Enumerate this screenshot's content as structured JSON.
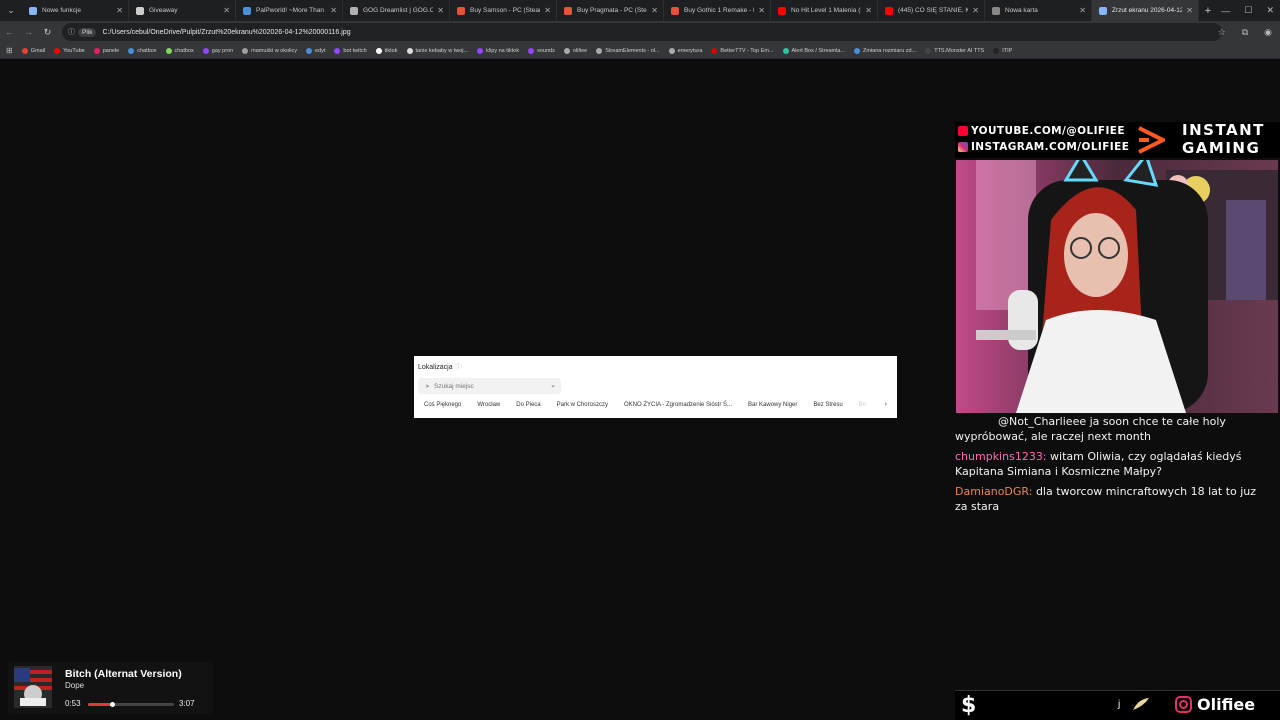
{
  "browser": {
    "tabs": [
      {
        "title": "Nowe funkcje",
        "color": "#8ab4f8",
        "active": false
      },
      {
        "title": "Giveaway",
        "color": "#cccccc",
        "active": false
      },
      {
        "title": "PalPworld! ~More Than a",
        "color": "#4a90d9",
        "active": false
      },
      {
        "title": "GOG Dreamlist | GOG.COM",
        "color": "#b0b0b0",
        "active": false
      },
      {
        "title": "Buy Samson - PC (Steam)",
        "color": "#e8523a",
        "active": false
      },
      {
        "title": "Buy Pragmata - PC (Steam)",
        "color": "#e8523a",
        "active": false
      },
      {
        "title": "Buy Gothic 1 Remake - P",
        "color": "#e8523a",
        "active": false
      },
      {
        "title": "No Hit Level 1 Malenia (B",
        "color": "#ff0000",
        "active": false
      },
      {
        "title": "(445) CO SIĘ STANIE, KIED",
        "color": "#ff0000",
        "active": false
      },
      {
        "title": "Nowa karta",
        "color": "#888888",
        "active": false
      },
      {
        "title": "Zrzut ekranu 2026-04-12",
        "color": "#8ab4f8",
        "active": true
      }
    ],
    "new_tab": "+",
    "site_chip": "Plik",
    "url": "C:/Users/cebul/OneDrive/Pulpit/Zrzut%20ekranu%202026-04-12%20000116.jpg",
    "bookmarks": [
      {
        "label": "Gmail",
        "color": "#ea4335"
      },
      {
        "label": "YouTube",
        "color": "#ff0000"
      },
      {
        "label": "panele",
        "color": "#e91e63"
      },
      {
        "label": "chatbox",
        "color": "#4a90d9"
      },
      {
        "label": "chatbox",
        "color": "#7ed957"
      },
      {
        "label": "gay pron",
        "color": "#9146ff"
      },
      {
        "label": "mamuśki w okolicy",
        "color": "#9e9e9e"
      },
      {
        "label": "edyt",
        "color": "#4a90d9"
      },
      {
        "label": "bot twitch",
        "color": "#9146ff"
      },
      {
        "label": "tiktok",
        "color": "#ffffff"
      },
      {
        "label": "tanie kebaby w twoj...",
        "color": "#dddddd"
      },
      {
        "label": "klipy na tiktok",
        "color": "#9146ff"
      },
      {
        "label": "sounds",
        "color": "#9146ff"
      },
      {
        "label": "olifiee",
        "color": "#aaaaaa"
      },
      {
        "label": "StreamElements - ol...",
        "color": "#aaaaaa"
      },
      {
        "label": "emerytura",
        "color": "#aaaaaa"
      },
      {
        "label": "BetterTTV - Top Em...",
        "color": "#d50000"
      },
      {
        "label": "Alert Box / Streamla...",
        "color": "#31c3a2"
      },
      {
        "label": "Zmiana rozmiaru zd...",
        "color": "#4a90d9"
      },
      {
        "label": "TTS.Monster AI TTS",
        "color": "#444444"
      },
      {
        "label": "ITIP",
        "color": "#222222"
      }
    ]
  },
  "dialog": {
    "label": "Lokalizacja",
    "info_icon": "ⓘ",
    "search_placeholder": "Szukaj miejsc",
    "chips": [
      "Coś Pięknego",
      "Wrocław",
      "Do Pieca",
      "Park w Choroszczy",
      "OKNO ŻYCIA - Zgromadzenie Sióstr Ś...",
      "Bar Kawowy Niger",
      "Bez Stresu",
      "Bo"
    ]
  },
  "overlay": {
    "youtube": "YOUTUBE.COM/@OLIFIEE",
    "instagram": "INSTAGRAM.COM/OLIFIEE",
    "sponsor_line1": "INSTANT",
    "sponsor_line2": "GAMING",
    "chat": [
      {
        "user": "",
        "user_color": "#ffffff",
        "text": "@Not_Charlieee ja soon chce te całe holy wypróbować, ale raczej next month"
      },
      {
        "user": "chumpkins1233:",
        "user_color": "#ff69b4",
        "text": "witam Oliwia, czy oglądałaś kiedyś Kapitana Simiana i Kosmiczne Małpy?"
      },
      {
        "user": "DamianoDGR:",
        "user_color": "#e9855a",
        "text": "dla tworcow mincraftowych 18 lat to juz za stara"
      }
    ],
    "bottom_dollar": "$",
    "bottom_j": "j",
    "bottom_name": "Olifiee"
  },
  "media": {
    "title": "Bitch (Alternat Version)",
    "artist": "Dope",
    "current_time": "0:53",
    "total_time": "3:07",
    "progress": 0.283
  },
  "colors": {
    "accent_red": "#e0363d",
    "instant_orange": "#ff5a1f"
  }
}
